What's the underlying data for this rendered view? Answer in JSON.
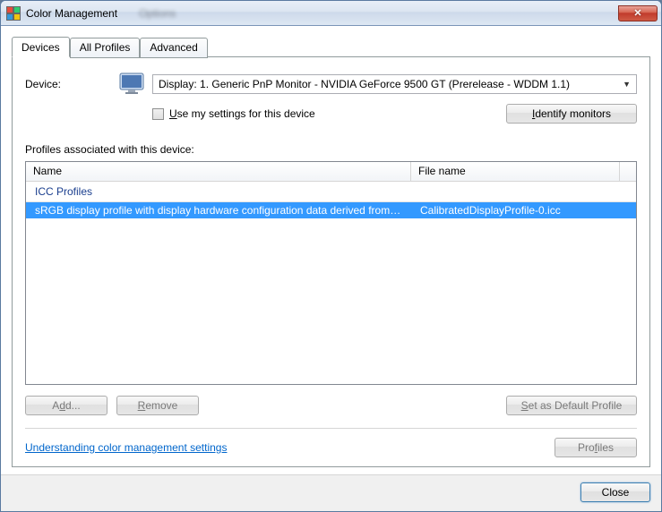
{
  "window": {
    "title": "Color Management",
    "ghost": "Options"
  },
  "tabs": {
    "devices": "Devices",
    "all_profiles": "All Profiles",
    "advanced": "Advanced"
  },
  "device": {
    "label": "Device:",
    "selected": "Display: 1. Generic PnP Monitor - NVIDIA GeForce 9500 GT (Prerelease - WDDM 1.1)",
    "use_my_settings": "Use my settings for this device",
    "identify_btn": "Identify monitors"
  },
  "profiles": {
    "section_label": "Profiles associated with this device:",
    "col_name": "Name",
    "col_file": "File name",
    "group_icc": "ICC Profiles",
    "rows": [
      {
        "name": "sRGB display profile with display hardware configuration data derived from cali...",
        "file": "CalibratedDisplayProfile-0.icc"
      }
    ]
  },
  "buttons": {
    "add": "Add...",
    "remove": "Remove",
    "set_default": "Set as Default Profile",
    "profiles": "Profiles",
    "close": "Close"
  },
  "link": {
    "understanding": "Understanding color management settings"
  }
}
